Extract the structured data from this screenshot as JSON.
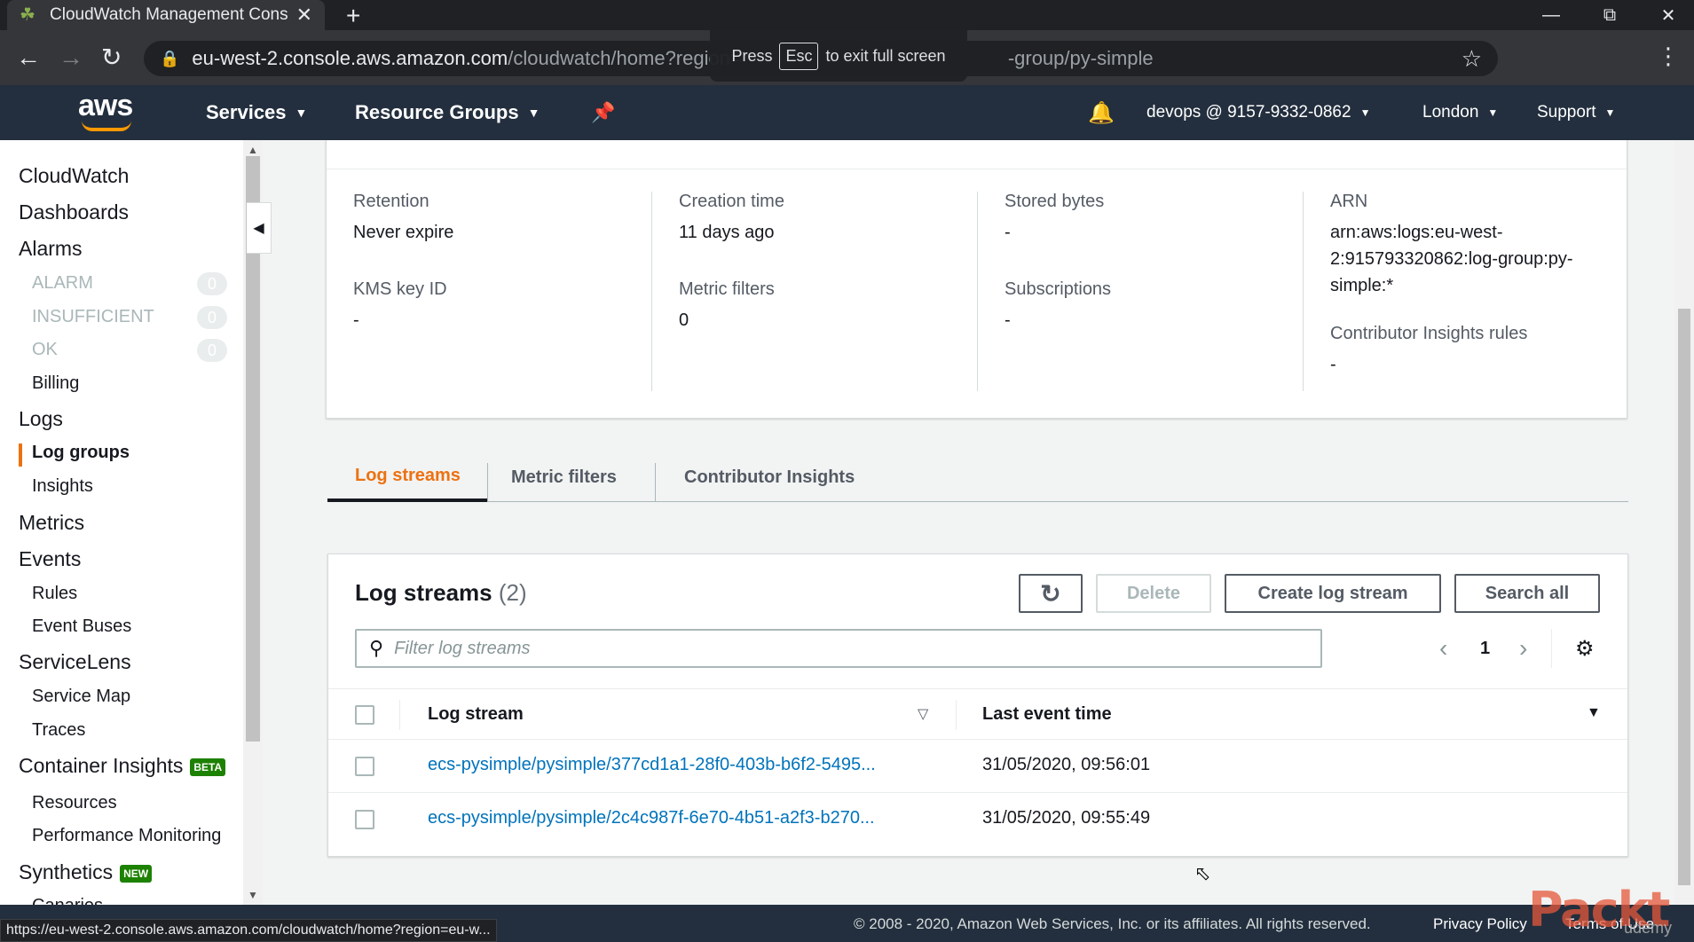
{
  "browser": {
    "tab_title": "CloudWatch Management Conso",
    "new_tab": "+",
    "url_host": "eu-west-2.console.aws.amazon.com",
    "url_path": "/cloudwatch/home?region=",
    "url_tail": "-group/py-simple",
    "fullscreen_press": "Press",
    "fullscreen_key": "Esc",
    "fullscreen_msg": "to exit full screen",
    "status_url": "https://eu-west-2.console.aws.amazon.com/cloudwatch/home?region=eu-w..."
  },
  "aws_header": {
    "logo": "aws",
    "services": "Services",
    "resource_groups": "Resource Groups",
    "account": "devops @ 9157-9332-0862",
    "region": "London",
    "support": "Support"
  },
  "sidebar": {
    "cloudwatch": "CloudWatch",
    "dashboards": "Dashboards",
    "alarms": "Alarms",
    "alarm_states": [
      {
        "label": "ALARM",
        "count": "0"
      },
      {
        "label": "INSUFFICIENT",
        "count": "0"
      },
      {
        "label": "OK",
        "count": "0"
      }
    ],
    "billing": "Billing",
    "logs": "Logs",
    "log_groups": "Log groups",
    "insights": "Insights",
    "metrics": "Metrics",
    "events": "Events",
    "rules": "Rules",
    "event_buses": "Event Buses",
    "servicelens": "ServiceLens",
    "service_map": "Service Map",
    "traces": "Traces",
    "container_insights": "Container Insights",
    "beta_badge": "BETA",
    "resources": "Resources",
    "performance_monitoring": "Performance Monitoring",
    "synthetics": "Synthetics",
    "new_badge": "NEW",
    "canaries": "Canaries"
  },
  "details": {
    "retention_label": "Retention",
    "retention_value": "Never expire",
    "kms_label": "KMS key ID",
    "kms_value": "-",
    "creation_label": "Creation time",
    "creation_value": "11 days ago",
    "metric_filters_label": "Metric filters",
    "metric_filters_value": "0",
    "stored_label": "Stored bytes",
    "stored_value": "-",
    "subscriptions_label": "Subscriptions",
    "subscriptions_value": "-",
    "arn_label": "ARN",
    "arn_value_1": "arn:aws:logs:eu-west-",
    "arn_value_2": "2:915793320862:log-group:py-",
    "arn_value_3": "simple:*",
    "contrib_label": "Contributor Insights rules",
    "contrib_value": "-"
  },
  "tabs": [
    "Log streams",
    "Metric filters",
    "Contributor Insights"
  ],
  "streams": {
    "title": "Log streams",
    "count": "(2)",
    "delete": "Delete",
    "create": "Create log stream",
    "search_all": "Search all",
    "filter_placeholder": "Filter log streams",
    "page": "1",
    "col_stream": "Log stream",
    "col_time": "Last event time",
    "rows": [
      {
        "name": "ecs-pysimple/pysimple/377cd1a1-28f0-403b-b6f2-5495...",
        "time": "31/05/2020, 09:56:01"
      },
      {
        "name": "ecs-pysimple/pysimple/2c4c987f-6e70-4b51-a2f3-b270...",
        "time": "31/05/2020, 09:55:49"
      }
    ]
  },
  "footer": {
    "copyright": "© 2008 - 2020, Amazon Web Services, Inc. or its affiliates. All rights reserved.",
    "privacy": "Privacy Policy",
    "terms": "Terms of Use"
  },
  "watermark": {
    "brand": "Packt",
    "sub": "udemy"
  },
  "colors": {
    "accent": "#ec7211",
    "link": "#0073bb",
    "header": "#232f3e",
    "aws_orange": "#ff9900"
  }
}
